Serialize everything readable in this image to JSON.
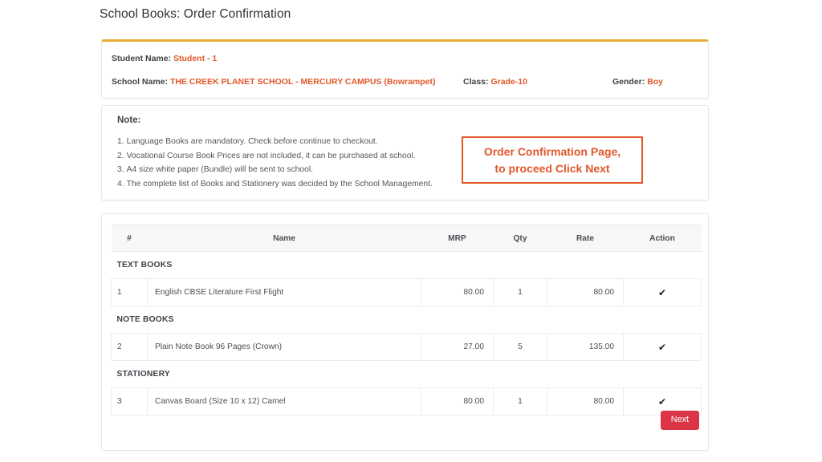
{
  "page": {
    "title": "School Books: Order Confirmation",
    "background_color": "#ffffff"
  },
  "colors": {
    "accent_top_border": "#e7ae37",
    "value_orange": "#e2572a",
    "callout_border": "#e2572a",
    "next_button": "#dc3545",
    "table_header_bg": "#f7f7f7"
  },
  "student_card": {
    "student_name_label": "Student Name:",
    "student_name_value": "Student - 1",
    "school_name_label": "School Name:",
    "school_name_value": "THE CREEK PLANET SCHOOL - MERCURY CAMPUS (Bowrampet)",
    "class_label": "Class:",
    "class_value": "Grade-10",
    "gender_label": "Gender:",
    "gender_value": "Boy"
  },
  "note_card": {
    "title": "Note:",
    "items": [
      {
        "num": "1.",
        "text": "Language Books are mandatory. Check before continue to checkout."
      },
      {
        "num": "2.",
        "text": "Vocational Course Book Prices are not included, it can be purchased at school."
      },
      {
        "num": "3.",
        "text": "A4 size white paper (Bundle) will be sent to school."
      },
      {
        "num": "4.",
        "text": "The complete list of Books and Stationery was decided by the School Management."
      }
    ]
  },
  "callout": {
    "line1": "Order Confirmation Page,",
    "line2": "to proceed Click Next"
  },
  "order_table": {
    "headers": {
      "index": "#",
      "name": "Name",
      "mrp": "MRP",
      "qty": "Qty",
      "rate": "Rate",
      "action": "Action"
    },
    "sections": [
      {
        "title": "TEXT BOOKS",
        "rows": [
          {
            "index": "1",
            "name": "English CBSE Literature First Flight",
            "mrp": "80.00",
            "qty": "1",
            "rate": "80.00",
            "action": "✔"
          }
        ]
      },
      {
        "title": "NOTE BOOKS",
        "rows": [
          {
            "index": "2",
            "name": "Plain Note Book 96 Pages (Crown)",
            "mrp": "27.00",
            "qty": "5",
            "rate": "135.00",
            "action": "✔"
          }
        ]
      },
      {
        "title": "STATIONERY",
        "rows": [
          {
            "index": "3",
            "name": "Canvas Board (Size 10 x 12) Camel",
            "mrp": "80.00",
            "qty": "1",
            "rate": "80.00",
            "action": "✔"
          }
        ]
      }
    ],
    "next_button_label": "Next"
  }
}
